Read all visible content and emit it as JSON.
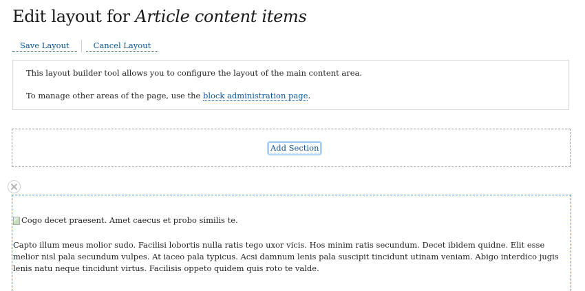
{
  "page": {
    "title_prefix": "Edit layout for ",
    "title_entity": "Article content items"
  },
  "actions": {
    "save_label": "Save Layout",
    "cancel_label": "Cancel Layout"
  },
  "info": {
    "line1": "This layout builder tool allows you to configure the layout of the main content area.",
    "line2_prefix": "To manage other areas of the page, use the ",
    "line2_link": "block administration page",
    "line2_suffix": "."
  },
  "section": {
    "add_label": "Add Section"
  },
  "content": {
    "image_alt": "Cogo decet praesent. Amet caecus et probo similis te.",
    "body": "Capto illum meus molior sudo. Facilisi lobortis nulla ratis tego uxor vicis. Hos minim ratis secundum. Decet ibidem quidne. Elit esse melior nisl pala secundum vulpes. At iaceo pala typicus. Acsi damnum lenis pala suscipit tincidunt utinam veniam. Abigo interdico jugis lenis natu neque tincidunt virtus. Facilisis oppeto quidem quis roto te valde."
  },
  "icons": {
    "close": "close-icon",
    "broken_image": "broken-image-icon"
  }
}
